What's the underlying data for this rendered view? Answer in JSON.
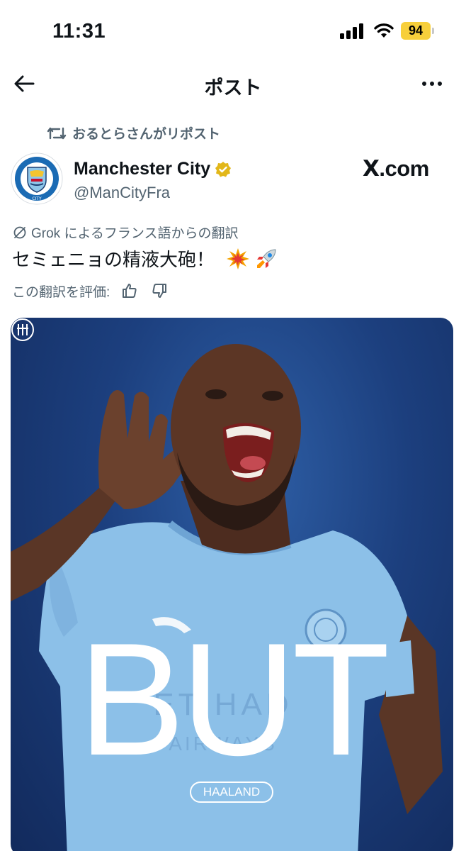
{
  "status_bar": {
    "time": "11:31",
    "battery": "94"
  },
  "nav": {
    "title": "ポスト"
  },
  "repost": {
    "text": "おるとらさんがリポスト"
  },
  "author": {
    "name": "Manchester City",
    "handle": "@ManCityFra",
    "verified": true
  },
  "brand": {
    "prefix": "X",
    "suffix": ".com"
  },
  "translation": {
    "source_label": "Grok によるフランス語からの翻訳",
    "text": "セミェニョの精液大砲！",
    "emojis": [
      "collision-icon",
      "rocket-icon"
    ],
    "rate_label": "この翻訳を評価:"
  },
  "media": {
    "headline": "BUT",
    "player": "HAALAND"
  },
  "colors": {
    "text": "#0f1419",
    "secondary": "#536471",
    "verified": "#e2b719",
    "battery": "#f7cf3b",
    "media_bg": "#1c3f7e",
    "jersey": "#8cc0e8"
  }
}
